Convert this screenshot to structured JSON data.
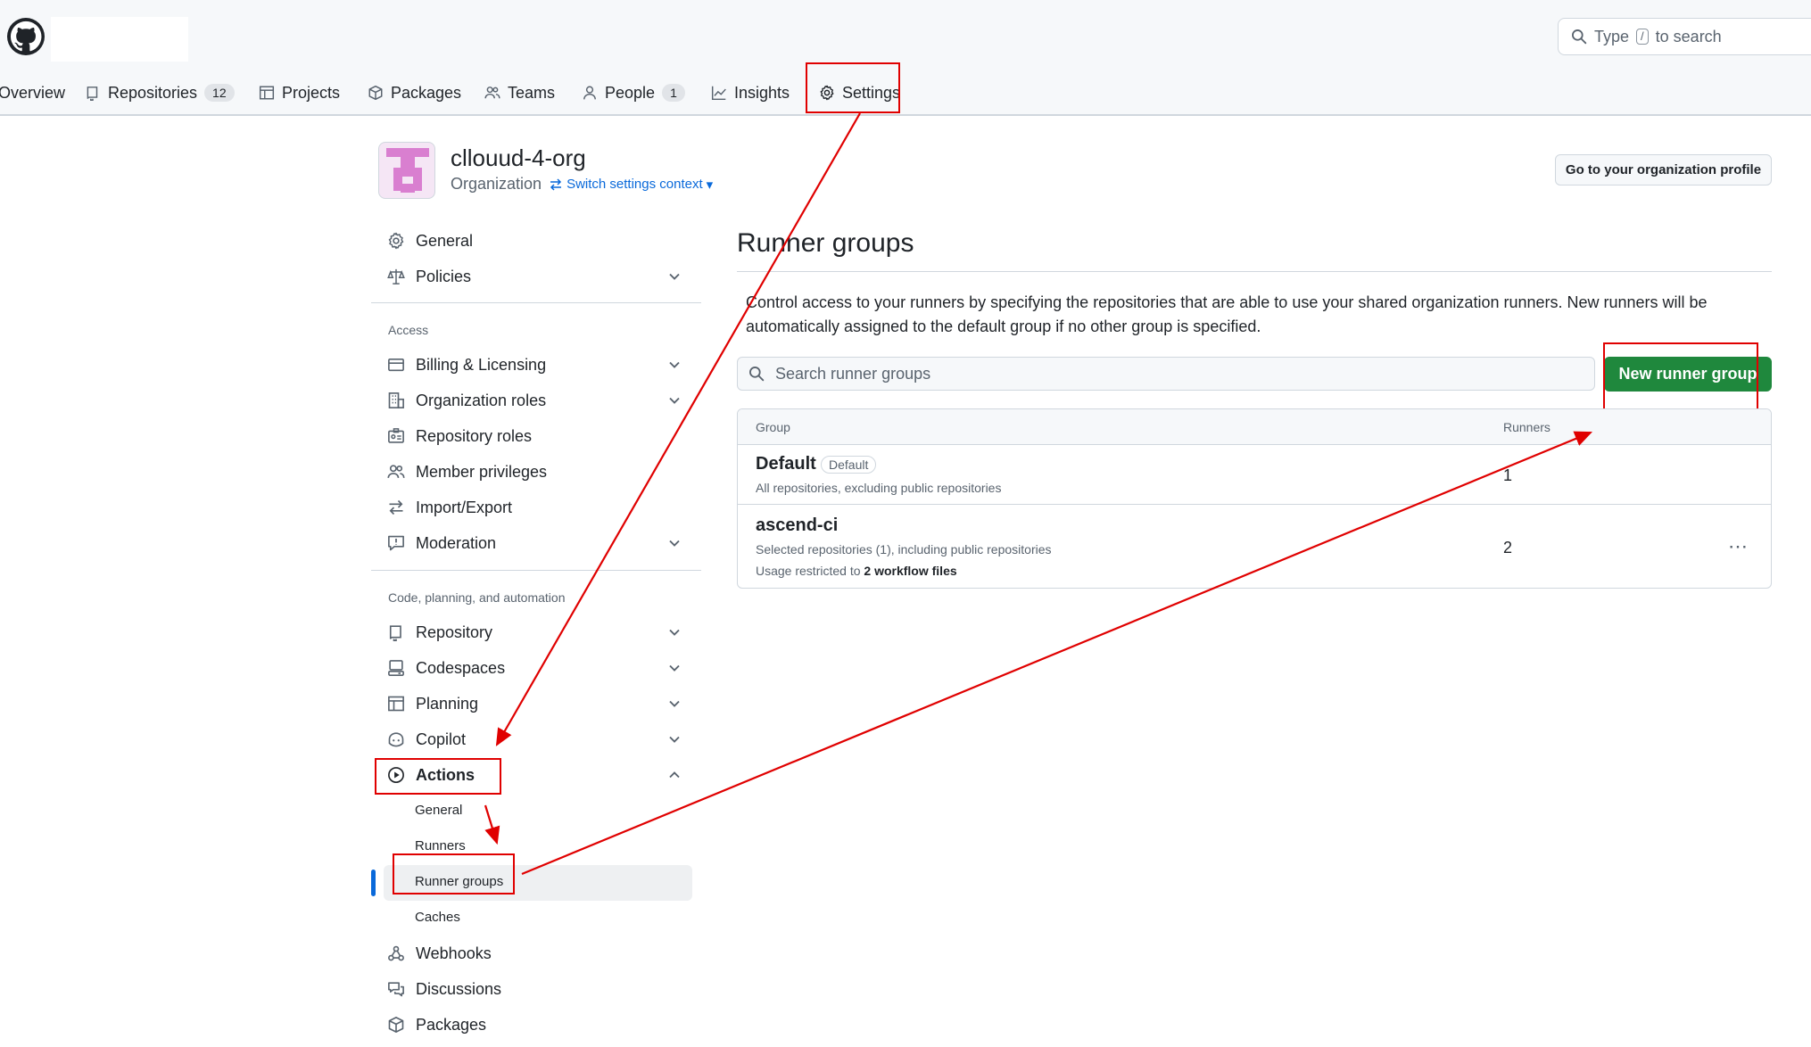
{
  "header": {
    "search_prefix": "Type",
    "search_key": "/",
    "search_suffix": "to search"
  },
  "org_nav": [
    {
      "label": "Overview",
      "icon": "home-icon"
    },
    {
      "label": "Repositories",
      "icon": "repo-icon",
      "count": "12"
    },
    {
      "label": "Projects",
      "icon": "table-icon"
    },
    {
      "label": "Packages",
      "icon": "package-icon"
    },
    {
      "label": "Teams",
      "icon": "people-icon"
    },
    {
      "label": "People",
      "icon": "person-icon",
      "count": "1"
    },
    {
      "label": "Insights",
      "icon": "graph-icon"
    },
    {
      "label": "Settings",
      "icon": "gear-icon",
      "selected": true
    }
  ],
  "org": {
    "name": "cllouud-4-org",
    "type": "Organization",
    "switch_label": "Switch settings context",
    "profile_button": "Go to your organization profile"
  },
  "sidebar": {
    "top_items": [
      {
        "label": "General",
        "icon": "gear-icon"
      },
      {
        "label": "Policies",
        "icon": "law-icon",
        "expandable": true
      }
    ],
    "access_heading": "Access",
    "access_items": [
      {
        "label": "Billing & Licensing",
        "icon": "credit-card-icon",
        "expandable": true
      },
      {
        "label": "Organization roles",
        "icon": "organization-icon",
        "expandable": true
      },
      {
        "label": "Repository roles",
        "icon": "id-badge-icon"
      },
      {
        "label": "Member privileges",
        "icon": "people-icon"
      },
      {
        "label": "Import/Export",
        "icon": "arrow-switch-icon"
      },
      {
        "label": "Moderation",
        "icon": "report-icon",
        "expandable": true
      }
    ],
    "code_heading": "Code, planning, and automation",
    "code_items": [
      {
        "label": "Repository",
        "icon": "repo-icon",
        "expandable": true
      },
      {
        "label": "Codespaces",
        "icon": "codespaces-icon",
        "expandable": true
      },
      {
        "label": "Planning",
        "icon": "table-icon",
        "expandable": true
      },
      {
        "label": "Copilot",
        "icon": "copilot-icon",
        "expandable": true
      },
      {
        "label": "Actions",
        "icon": "play-icon",
        "expanded": true
      }
    ],
    "actions_sub": [
      {
        "label": "General"
      },
      {
        "label": "Runners"
      },
      {
        "label": "Runner groups",
        "active": true
      },
      {
        "label": "Caches"
      }
    ],
    "bottom_items": [
      {
        "label": "Webhooks",
        "icon": "webhook-icon"
      },
      {
        "label": "Discussions",
        "icon": "comment-discussion-icon"
      },
      {
        "label": "Packages",
        "icon": "package-icon"
      }
    ]
  },
  "main": {
    "title": "Runner groups",
    "description": "Control access to your runners by specifying the repositories that are able to use your shared organization runners. New runners will be automatically assigned to the default group if no other group is specified.",
    "search_placeholder": "Search runner groups",
    "new_button": "New runner group",
    "table": {
      "col_group": "Group",
      "col_runners": "Runners",
      "rows": [
        {
          "name": "Default",
          "badge": "Default",
          "scope": "All repositories, excluding public repositories",
          "runners": "1"
        },
        {
          "name": "ascend-ci",
          "scope": "Selected repositories (1), including public repositories",
          "restriction_prefix": "Usage restricted to",
          "restriction_value": "2 workflow files",
          "runners": "2"
        }
      ]
    }
  },
  "colors": {
    "accent_blue": "#0969da",
    "primary_green": "#1f883d",
    "annotation_red": "#e00000",
    "avatar_pink": "#d97fd0"
  }
}
